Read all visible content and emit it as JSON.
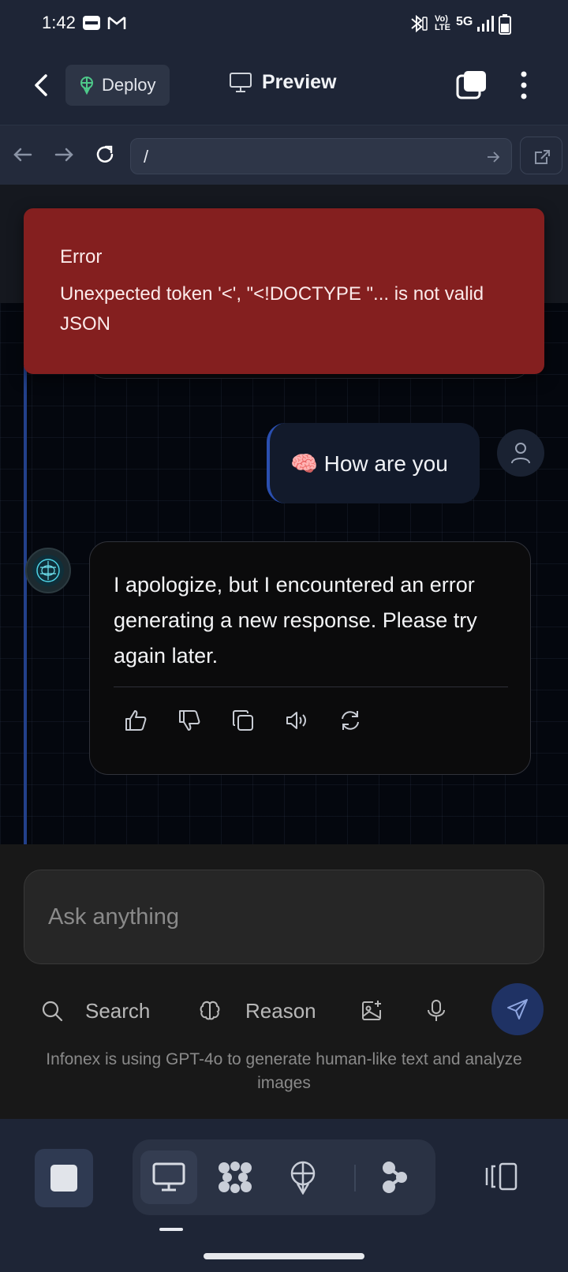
{
  "status_bar": {
    "time": "1:42",
    "network": "5G",
    "volte": "Vo) LTE",
    "icons": [
      "paytm-icon",
      "gmail-icon",
      "bluetooth-icon",
      "volte-icon",
      "signal-icon",
      "battery-icon"
    ]
  },
  "header": {
    "deploy_label": "Deploy",
    "title": "Preview"
  },
  "browser": {
    "url": "/"
  },
  "chat": {
    "error": {
      "title": "Error",
      "message": "Unexpected token '<', \"<!DOCTYPE \"... is not valid JSON"
    },
    "user_message": "🧠 How are you",
    "assistant_message": "I apologize, but I encountered an error generating a new response. Please try again later.",
    "actions": [
      "thumbs-up-icon",
      "thumbs-down-icon",
      "copy-icon",
      "speaker-icon",
      "regenerate-icon"
    ]
  },
  "composer": {
    "placeholder": "Ask anything",
    "search_label": "Search",
    "reason_label": "Reason",
    "disclaimer": "Infonex is using GPT-4o to generate human-like text and analyze images"
  },
  "colors": {
    "error_bg": "#841f1f",
    "accent_blue": "#2a4fb0",
    "send_bg": "#1f3264",
    "deploy_green": "#4ec98a"
  }
}
